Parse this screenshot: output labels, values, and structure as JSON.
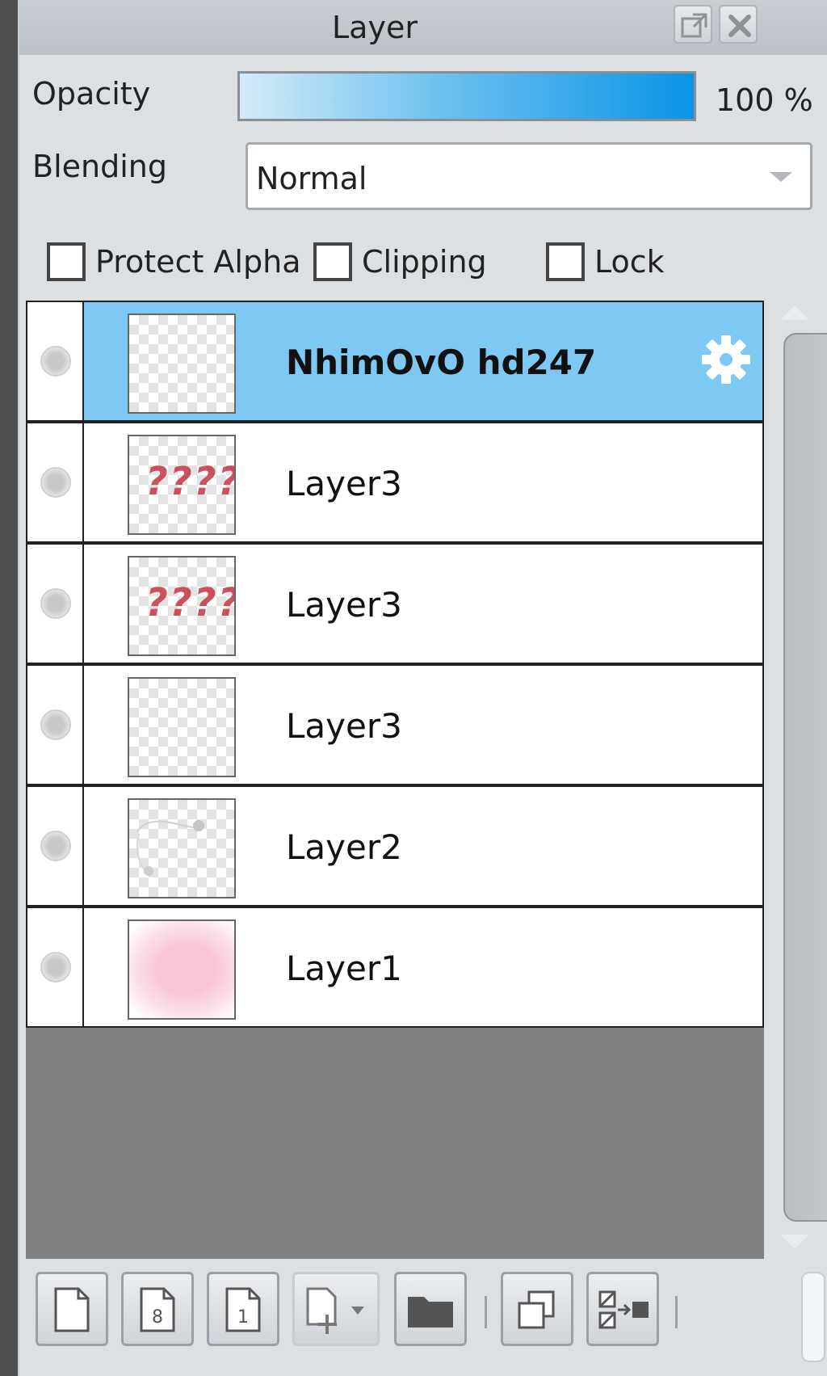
{
  "panel": {
    "title": "Layer"
  },
  "opacity": {
    "label": "Opacity",
    "value_text": "100 %",
    "value": 100
  },
  "blending": {
    "label": "Blending",
    "selected": "Normal"
  },
  "options": {
    "protect_alpha": {
      "label": "Protect Alpha",
      "checked": false
    },
    "clipping": {
      "label": "Clipping",
      "checked": false
    },
    "lock": {
      "label": "Lock",
      "checked": false
    }
  },
  "layers": [
    {
      "name": "NhimOvO hd247",
      "selected": true,
      "thumb": "empty"
    },
    {
      "name": "Layer3",
      "selected": false,
      "thumb": "text",
      "thumb_text": "????"
    },
    {
      "name": "Layer3",
      "selected": false,
      "thumb": "text",
      "thumb_text": "????"
    },
    {
      "name": "Layer3",
      "selected": false,
      "thumb": "empty"
    },
    {
      "name": "Layer2",
      "selected": false,
      "thumb": "sketch"
    },
    {
      "name": "Layer1",
      "selected": false,
      "thumb": "pink"
    }
  ],
  "toolbar": {
    "buttons": [
      "new-layer-icon",
      "new-8bit-layer-icon",
      "new-1bit-layer-icon",
      "add-layer-menu-icon",
      "new-folder-icon",
      "duplicate-layer-icon",
      "merge-down-icon"
    ],
    "thumb_8bit_label": "8",
    "thumb_1bit_label": "1"
  },
  "colors": {
    "selected_row": "#7dc9f4",
    "opacity_start": "#d4eaf8",
    "opacity_end": "#0a94e8"
  }
}
